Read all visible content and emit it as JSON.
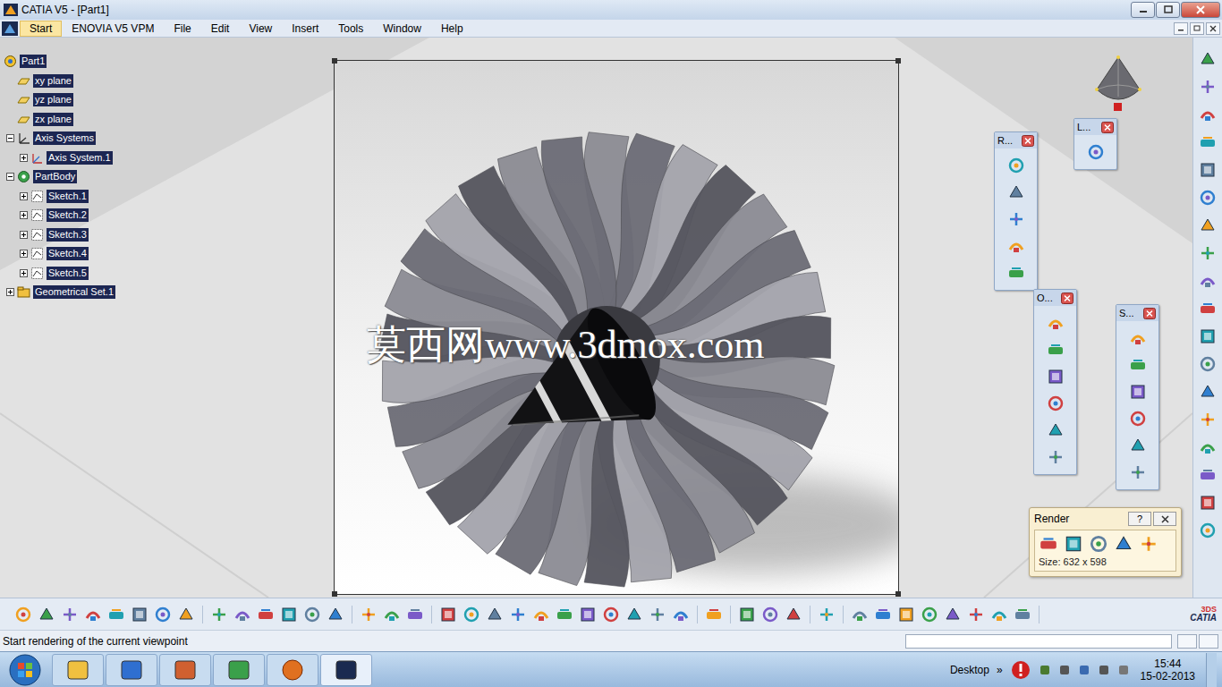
{
  "window": {
    "title": "CATIA V5 - [Part1]"
  },
  "menu": [
    {
      "label": "Start",
      "selected": true
    },
    {
      "label": "ENOVIA V5 VPM",
      "selected": false
    },
    {
      "label": "File",
      "selected": false
    },
    {
      "label": "Edit",
      "selected": false
    },
    {
      "label": "View",
      "selected": false
    },
    {
      "label": "Insert",
      "selected": false
    },
    {
      "label": "Tools",
      "selected": false
    },
    {
      "label": "Window",
      "selected": false
    },
    {
      "label": "Help",
      "selected": false
    }
  ],
  "tree": [
    {
      "label": "Part1",
      "kind": "part",
      "depth": 0,
      "selected": true
    },
    {
      "label": "xy plane",
      "kind": "plane",
      "depth": 1,
      "selected": true
    },
    {
      "label": "yz plane",
      "kind": "plane",
      "depth": 1,
      "selected": true
    },
    {
      "label": "zx plane",
      "kind": "plane",
      "depth": 1,
      "selected": true
    },
    {
      "label": "Axis Systems",
      "kind": "axes",
      "depth": 1,
      "selected": true,
      "expanded": true
    },
    {
      "label": "Axis System.1",
      "kind": "axis",
      "depth": 2,
      "selected": true,
      "expanded": false
    },
    {
      "label": "PartBody",
      "kind": "body",
      "depth": 1,
      "selected": true,
      "expanded": true
    },
    {
      "label": "Sketch.1",
      "kind": "sketch",
      "depth": 2,
      "selected": true,
      "expanded": false
    },
    {
      "label": "Sketch.2",
      "kind": "sketch",
      "depth": 2,
      "selected": true,
      "expanded": false
    },
    {
      "label": "Sketch.3",
      "kind": "sketch",
      "depth": 2,
      "selected": true,
      "expanded": false
    },
    {
      "label": "Sketch.4",
      "kind": "sketch",
      "depth": 2,
      "selected": true,
      "expanded": false
    },
    {
      "label": "Sketch.5",
      "kind": "sketch",
      "depth": 2,
      "selected": true,
      "expanded": false
    },
    {
      "label": "Geometrical Set.1",
      "kind": "geoset",
      "depth": 1,
      "selected": true,
      "expanded": false
    }
  ],
  "floating_toolbars": [
    {
      "title": "R..."
    },
    {
      "title": "L..."
    },
    {
      "title": "O..."
    },
    {
      "title": "S..."
    }
  ],
  "render_dialog": {
    "title": "Render",
    "help": "?",
    "size": "Size: 632 x 598"
  },
  "render_view": {
    "watermark": "莫西网www.3dmox.com"
  },
  "brand": {
    "mark": "3DS",
    "name": "CATIA"
  },
  "status_bar": {
    "message": "Start rendering of the current viewpoint"
  },
  "taskbar": {
    "desktop": "Desktop",
    "chevron": "»",
    "time": "15:44",
    "date": "15-02-2013"
  }
}
